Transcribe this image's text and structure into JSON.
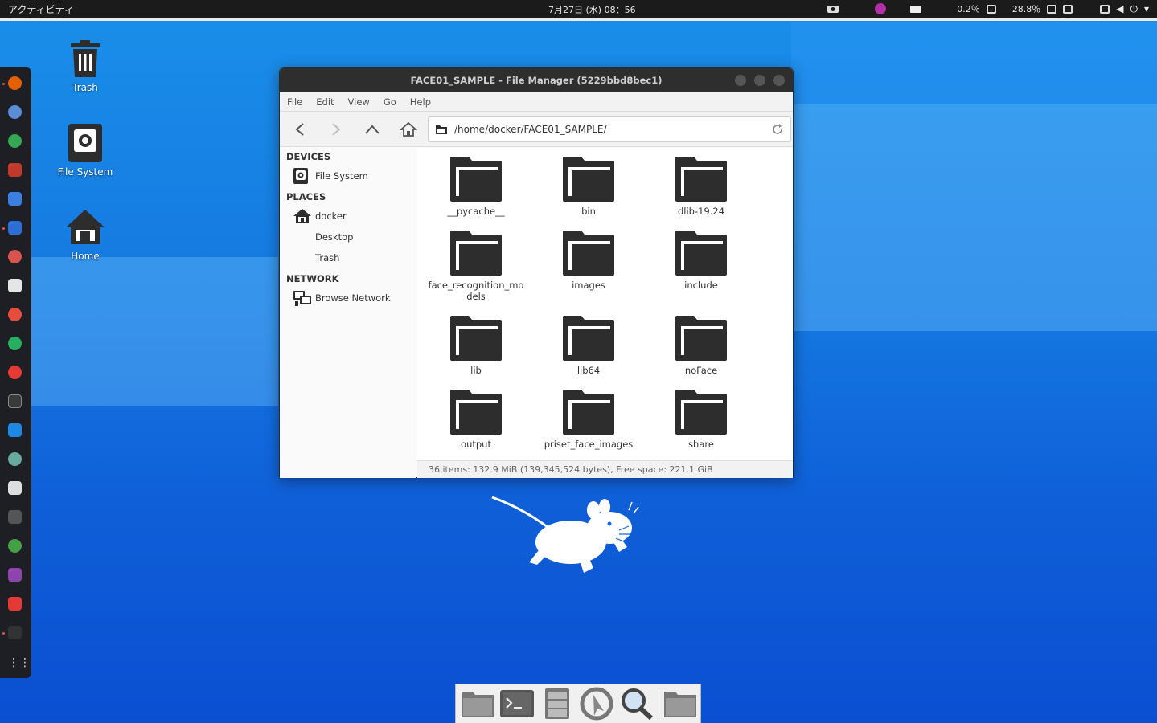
{
  "topbar": {
    "activities": "アクティビティ",
    "clock": "7月27日 (水) 08：56",
    "cpu": "0.2％",
    "mem": "28.8％"
  },
  "desktop": {
    "icons": [
      {
        "label": "Trash"
      },
      {
        "label": "File System"
      },
      {
        "label": "Home"
      }
    ]
  },
  "window": {
    "title": "FACE01_SAMPLE - File Manager (5229bbd8bec1)",
    "menu": [
      "File",
      "Edit",
      "View",
      "Go",
      "Help"
    ],
    "path": "/home/docker/FACE01_SAMPLE/",
    "sidebar": {
      "devices_title": "DEVICES",
      "devices": [
        "File System"
      ],
      "places_title": "PLACES",
      "places": [
        "docker",
        "Desktop",
        "Trash"
      ],
      "network_title": "NETWORK",
      "network": [
        "Browse Network"
      ]
    },
    "files": [
      "__pycache__",
      "bin",
      "dlib-19.24",
      "face_recognition_models",
      "images",
      "include",
      "lib",
      "lib64",
      "noFace",
      "output",
      "priset_face_images",
      "share"
    ],
    "status": "36 items: 132.9 MiB (139,345,524 bytes), Free space: 221.1 GiB"
  },
  "colors": {
    "folder": "#2d2d2d",
    "desktop_bg": "#1476e0",
    "titlebar": "#2e2e2e"
  }
}
